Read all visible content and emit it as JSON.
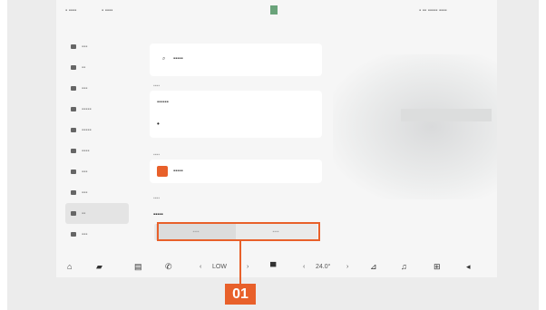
{
  "status": {
    "left_a": "▪ ▪▪▪▪",
    "left_b": "▪ ▪▪▪▪",
    "right": "▪ ▪▪ ▪▪▪▪▪ ▪▪▪▪"
  },
  "sidebar": {
    "items": [
      {
        "label": "▪▪▪"
      },
      {
        "label": "▪▪"
      },
      {
        "label": "▪▪▪"
      },
      {
        "label": "▪▪▪▪▪"
      },
      {
        "label": "▪▪▪▪▪"
      },
      {
        "label": "▪▪▪▪"
      },
      {
        "label": "▪▪▪"
      },
      {
        "label": "▪▪▪"
      },
      {
        "label": "▪▪"
      },
      {
        "label": "▪▪▪"
      }
    ]
  },
  "panel": {
    "search_value": "▪▪▪▪▪",
    "section1_label": "▪▪▪▪",
    "section1_value": "▪▪▪▪▪▪",
    "section2_label": "▪▪▪▪",
    "section2_value": "▪▪▪▪▪",
    "section3_label": "▪▪▪▪",
    "section3_title": "▪▪▪▪▪",
    "seg_left": "▪▪▪▪",
    "seg_right": "▪▪▪▪"
  },
  "dock": {
    "icons": [
      "home-icon",
      "car-icon",
      "apps-icon",
      "phone-icon"
    ],
    "fan_label": "LOW",
    "temperature": "24.0°",
    "right_icons": [
      "seat-icon",
      "music-icon",
      "grid-icon",
      "volume-icon"
    ]
  },
  "callout": {
    "label": "01"
  },
  "colors": {
    "accent": "#e8602a"
  }
}
